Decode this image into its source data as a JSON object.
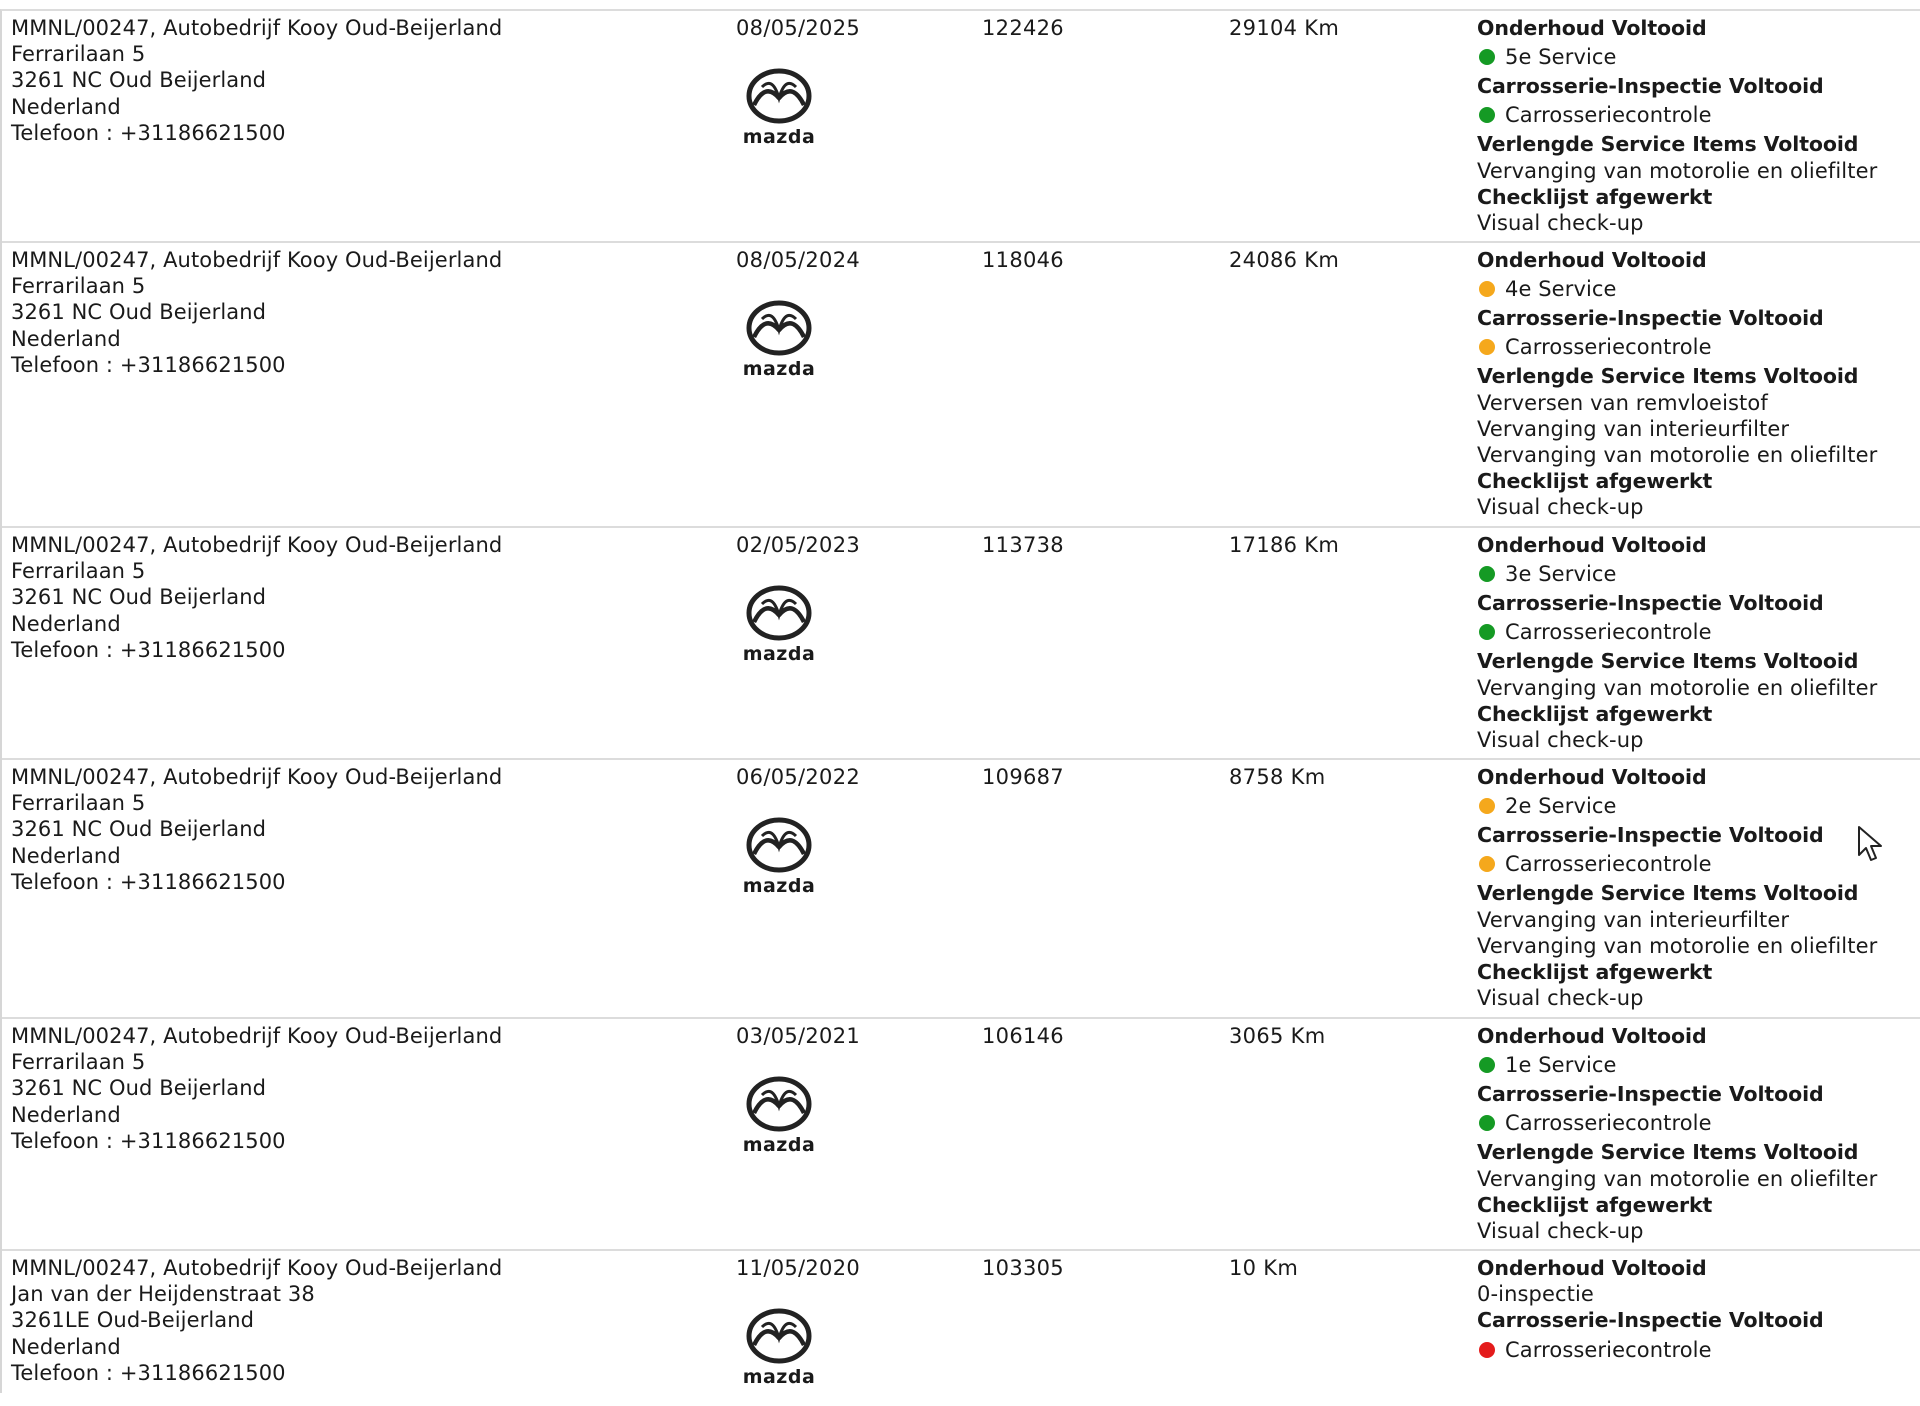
{
  "colors": {
    "green": "#159a24",
    "orange": "#f5a81c",
    "red": "#e41c1c",
    "divider": "#dcdcdc"
  },
  "icons": {
    "brand_logo": "mazda-logo-icon",
    "pointer": "mouse-cursor-icon"
  },
  "records": [
    {
      "dealer": [
        "MMNL/00247, Autobedrijf Kooy Oud-Beijerland",
        "Ferrarilaan 5",
        "3261 NC Oud Beijerland",
        "Nederland",
        "Telefoon : +31186621500"
      ],
      "date": "08/05/2025",
      "order_number": "122426",
      "mileage": "29104 Km",
      "logo_text": "mazda",
      "services": [
        {
          "text": "Onderhoud Voltooid",
          "style": "bold"
        },
        {
          "text": "5e Service",
          "status": "green"
        },
        {
          "text": "Carrosserie-Inspectie Voltooid",
          "style": "bold"
        },
        {
          "text": "Carrosseriecontrole",
          "status": "green"
        },
        {
          "text": "Verlengde Service Items Voltooid",
          "style": "bold"
        },
        {
          "text": "Vervanging van motorolie en oliefilter"
        },
        {
          "text": "Checklijst afgewerkt",
          "style": "bold"
        },
        {
          "text": "Visual check-up"
        }
      ]
    },
    {
      "dealer": [
        "MMNL/00247, Autobedrijf Kooy Oud-Beijerland",
        "Ferrarilaan 5",
        "3261 NC Oud Beijerland",
        "Nederland",
        "Telefoon : +31186621500"
      ],
      "date": "08/05/2024",
      "order_number": "118046",
      "mileage": "24086 Km",
      "logo_text": "mazda",
      "services": [
        {
          "text": "Onderhoud Voltooid",
          "style": "bold"
        },
        {
          "text": "4e Service",
          "status": "orange"
        },
        {
          "text": "Carrosserie-Inspectie Voltooid",
          "style": "bold"
        },
        {
          "text": "Carrosseriecontrole",
          "status": "orange"
        },
        {
          "text": "Verlengde Service Items Voltooid",
          "style": "bold"
        },
        {
          "text": "Verversen van remvloeistof"
        },
        {
          "text": "Vervanging van interieurfilter"
        },
        {
          "text": "Vervanging van motorolie en oliefilter"
        },
        {
          "text": "Checklijst afgewerkt",
          "style": "bold"
        },
        {
          "text": "Visual check-up"
        }
      ]
    },
    {
      "dealer": [
        "MMNL/00247, Autobedrijf Kooy Oud-Beijerland",
        "Ferrarilaan 5",
        "3261 NC Oud Beijerland",
        "Nederland",
        "Telefoon : +31186621500"
      ],
      "date": "02/05/2023",
      "order_number": "113738",
      "mileage": "17186 Km",
      "logo_text": "mazda",
      "services": [
        {
          "text": "Onderhoud Voltooid",
          "style": "bold"
        },
        {
          "text": "3e Service",
          "status": "green"
        },
        {
          "text": "Carrosserie-Inspectie Voltooid",
          "style": "bold"
        },
        {
          "text": "Carrosseriecontrole",
          "status": "green"
        },
        {
          "text": "Verlengde Service Items Voltooid",
          "style": "bold"
        },
        {
          "text": "Vervanging van motorolie en oliefilter"
        },
        {
          "text": "Checklijst afgewerkt",
          "style": "bold"
        },
        {
          "text": "Visual check-up"
        }
      ]
    },
    {
      "dealer": [
        "MMNL/00247, Autobedrijf Kooy Oud-Beijerland",
        "Ferrarilaan 5",
        "3261 NC Oud Beijerland",
        "Nederland",
        "Telefoon : +31186621500"
      ],
      "date": "06/05/2022",
      "order_number": "109687",
      "mileage": "8758 Km",
      "logo_text": "mazda",
      "services": [
        {
          "text": "Onderhoud Voltooid",
          "style": "bold"
        },
        {
          "text": "2e Service",
          "status": "orange"
        },
        {
          "text": "Carrosserie-Inspectie Voltooid",
          "style": "bold"
        },
        {
          "text": "Carrosseriecontrole",
          "status": "orange"
        },
        {
          "text": "Verlengde Service Items Voltooid",
          "style": "bold"
        },
        {
          "text": "Vervanging van interieurfilter"
        },
        {
          "text": "Vervanging van motorolie en oliefilter"
        },
        {
          "text": "Checklijst afgewerkt",
          "style": "bold"
        },
        {
          "text": "Visual check-up"
        }
      ]
    },
    {
      "dealer": [
        "MMNL/00247, Autobedrijf Kooy Oud-Beijerland",
        "Ferrarilaan 5",
        "3261 NC Oud Beijerland",
        "Nederland",
        "Telefoon : +31186621500"
      ],
      "date": "03/05/2021",
      "order_number": "106146",
      "mileage": "3065 Km",
      "logo_text": "mazda",
      "services": [
        {
          "text": "Onderhoud Voltooid",
          "style": "bold"
        },
        {
          "text": "1e Service",
          "status": "green"
        },
        {
          "text": "Carrosserie-Inspectie Voltooid",
          "style": "bold"
        },
        {
          "text": "Carrosseriecontrole",
          "status": "green"
        },
        {
          "text": "Verlengde Service Items Voltooid",
          "style": "bold"
        },
        {
          "text": "Vervanging van motorolie en oliefilter"
        },
        {
          "text": "Checklijst afgewerkt",
          "style": "bold"
        },
        {
          "text": "Visual check-up"
        }
      ]
    },
    {
      "dealer": [
        "MMNL/00247, Autobedrijf Kooy Oud-Beijerland",
        "Jan van der Heijdenstraat 38",
        "3261LE Oud-Beijerland",
        "Nederland",
        "Telefoon : +31186621500"
      ],
      "date": "11/05/2020",
      "order_number": "103305",
      "mileage": "10 Km",
      "logo_text": "mazda",
      "services": [
        {
          "text": "Onderhoud Voltooid",
          "style": "bold"
        },
        {
          "text": "0-inspectie"
        },
        {
          "text": "Carrosserie-Inspectie Voltooid",
          "style": "bold"
        },
        {
          "text": "Carrosseriecontrole",
          "status": "red"
        }
      ]
    }
  ]
}
